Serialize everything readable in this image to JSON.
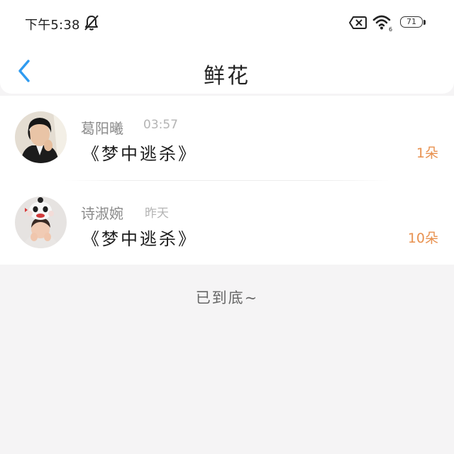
{
  "status_bar": {
    "time": "下午5:38",
    "battery_level": "71",
    "wifi_badge": "6",
    "icons": [
      "bell-muted-icon",
      "sim-x-icon",
      "wifi-icon",
      "battery-icon"
    ]
  },
  "nav": {
    "title": "鲜花",
    "back_icon": "chevron-left-icon",
    "accent_color": "#2f9bf0"
  },
  "items": [
    {
      "sender": "葛阳曦",
      "time": "03:57",
      "gift": "《梦中逃杀》",
      "count": "1朵"
    },
    {
      "sender": "诗淑婉",
      "time": "昨天",
      "gift": "《梦中逃杀》",
      "count": "10朵"
    }
  ],
  "footer": {
    "end_text": "已到底~"
  },
  "colors": {
    "count": "#e8914f",
    "background": "#f5f4f5"
  }
}
